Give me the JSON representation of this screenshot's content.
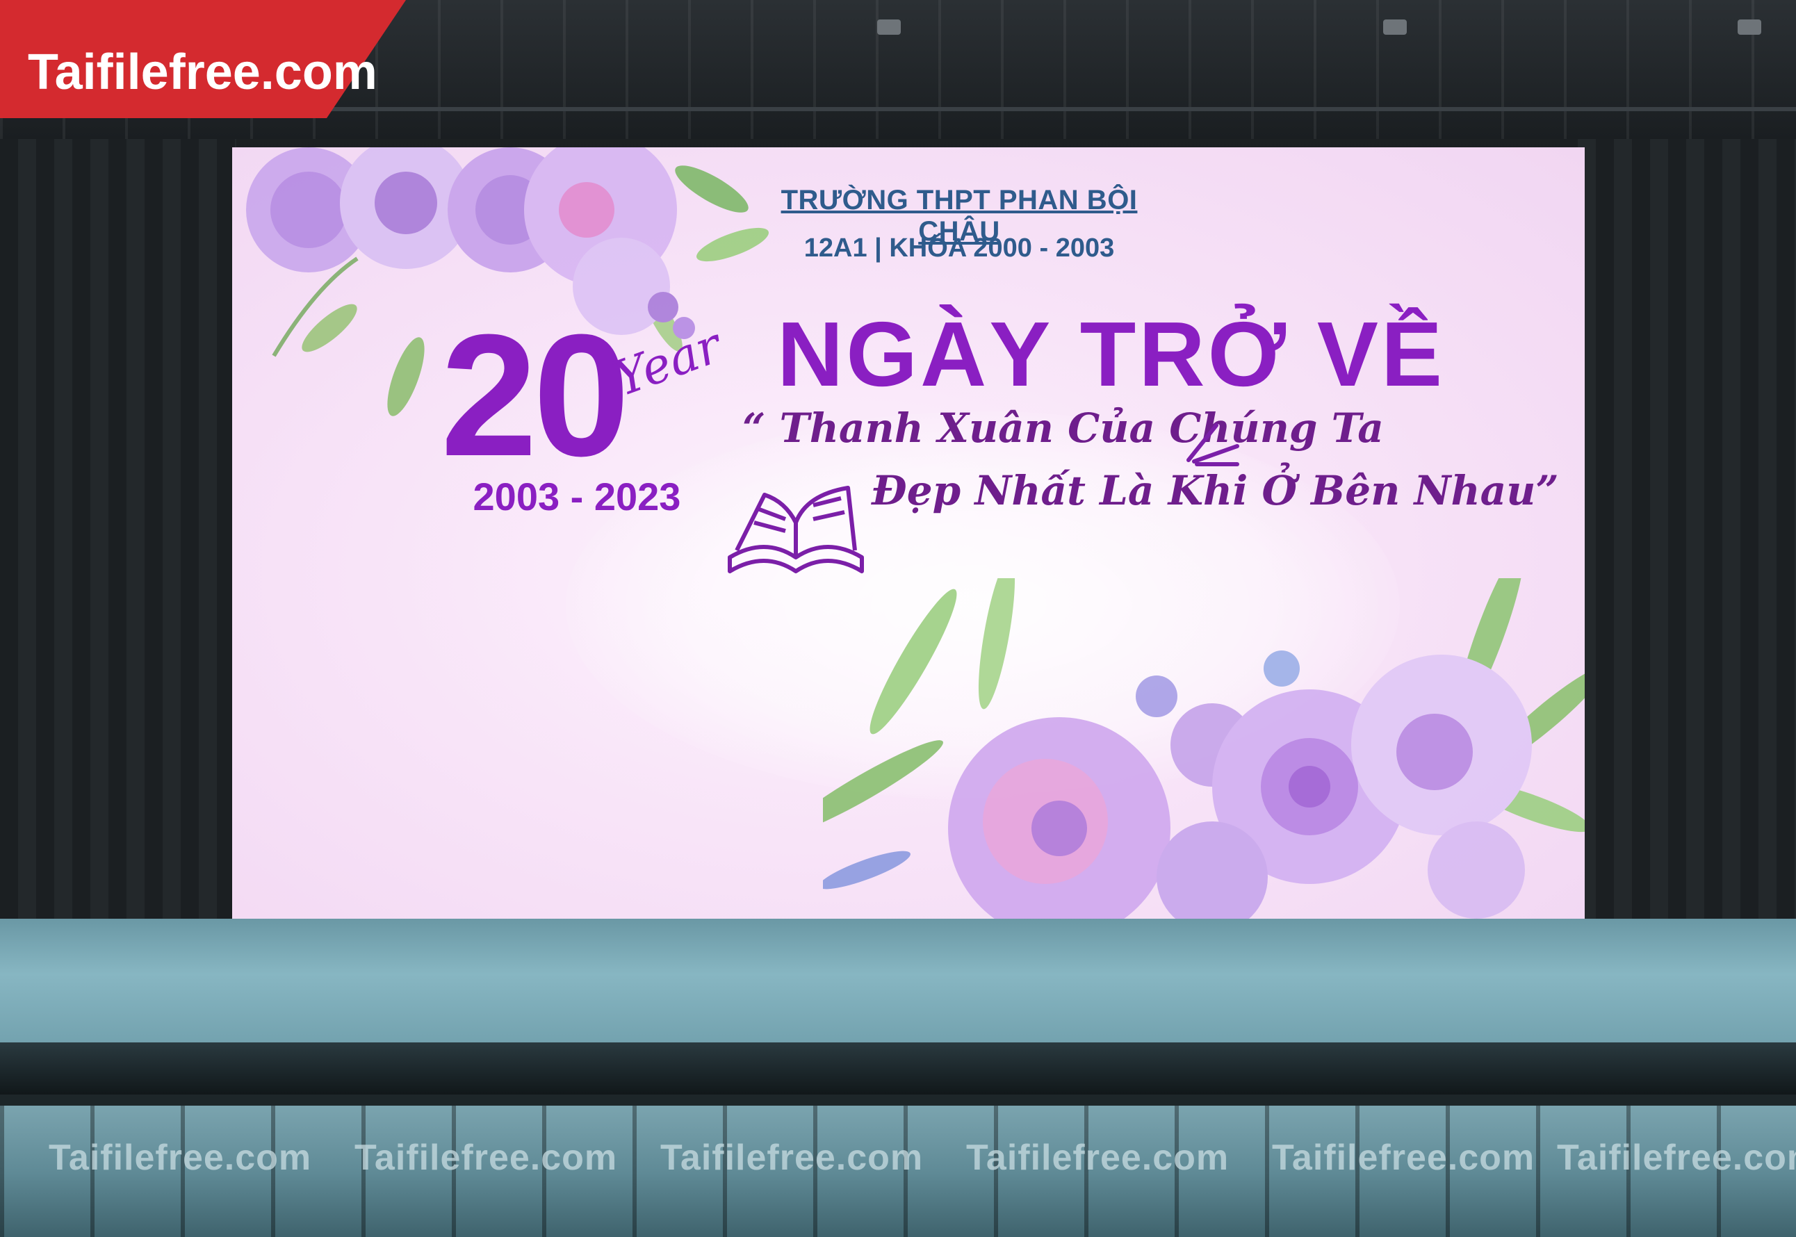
{
  "banner": {
    "school_name": "TRƯỜNG THPT PHAN BỘI CHÂU",
    "class_info": "12A1 | KHÓA 2000 - 2003",
    "big_number": "20",
    "year_script": "Year",
    "year_range": "2003 - 2023",
    "main_title": "NGÀY TRỞ VỀ",
    "quote_line_1": "“ Thanh Xuân Của Chúng Ta",
    "quote_line_2": "Đẹp Nhất Là Khi Ở Bên Nhau”"
  },
  "logo": {
    "text": "Taifilefree.com"
  },
  "watermarks": [
    "Taifilefree.com",
    "Taifilefree.com",
    "Taifilefree.com",
    "Taifilefree.com",
    "Taifilefree.com",
    "Taifilefree.com"
  ],
  "colors": {
    "accent_purple": "#8a1fc2",
    "heading_blue": "#2f5b8c",
    "banner_bg": "#f8e4f8",
    "logo_red": "#d42a2f"
  },
  "icons": [
    "book-icon",
    "spark-icon",
    "flower-cluster"
  ]
}
